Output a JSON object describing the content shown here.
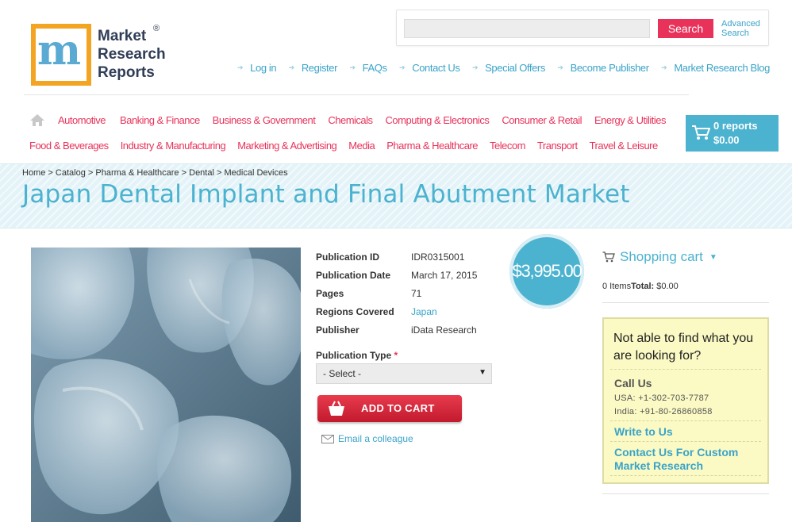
{
  "brand": {
    "logo_lines": [
      "Market",
      "Research",
      "Reports"
    ],
    "logo_mark": "m",
    "registered": "®"
  },
  "search": {
    "value": "",
    "placeholder": "",
    "button_label": "Search",
    "advanced_label_1": "Advanced",
    "advanced_label_2": "Search"
  },
  "top_links": [
    "Log in",
    "Register",
    "FAQs",
    "Contact Us",
    "Special Offers",
    "Become Publisher",
    "Market Research Blog"
  ],
  "categories_row1": [
    "Automotive",
    "Banking & Finance",
    "Business & Government",
    "Chemicals",
    "Computing & Electronics",
    "Consumer & Retail",
    "Energy & Utilities"
  ],
  "categories_row2": [
    "Food & Beverages",
    "Industry & Manufacturing",
    "Marketing & Advertising",
    "Media",
    "Pharma & Healthcare",
    "Telecom",
    "Transport",
    "Travel & Leisure"
  ],
  "header_cart": {
    "count_label": "0 reports",
    "total": "$0.00"
  },
  "breadcrumb": {
    "items": [
      "Home",
      "Catalog",
      "Pharma & Healthcare",
      "Dental",
      "Medical Devices"
    ],
    "separator": ">"
  },
  "page_title": "Japan Dental Implant and Final Abutment Market",
  "product": {
    "price": "$3,995.00",
    "details": [
      {
        "label": "Publication ID",
        "value": "IDR0315001"
      },
      {
        "label": "Publication Date",
        "value": "March 17, 2015"
      },
      {
        "label": "Pages",
        "value": "71"
      },
      {
        "label": "Regions Covered",
        "value": "Japan"
      },
      {
        "label": "Publisher",
        "value": "iData Research"
      }
    ],
    "publication_type_label": "Publication Type",
    "required_mark": "*",
    "publication_type_selected": "- Select -",
    "add_to_cart_label": "ADD TO CART",
    "email_colleague_label": "Email a colleague"
  },
  "sidebar": {
    "cart_title": "Shopping cart",
    "items_label": "0 Items",
    "total_label": "Total:",
    "total_value": "$0.00",
    "help_title": "Not able to find what you are looking for?",
    "call_us": "Call Us",
    "phone_usa": "USA: +1-302-703-7787",
    "phone_india": "India: +91-80-26860858",
    "write_to_us": "Write to Us",
    "contact_custom": "Contact Us For Custom Market Research"
  },
  "colors": {
    "accent_pink": "#e8325a",
    "accent_blue": "#4bb2cf",
    "link_blue": "#3aa3c9",
    "help_bg": "#fbfac4"
  }
}
